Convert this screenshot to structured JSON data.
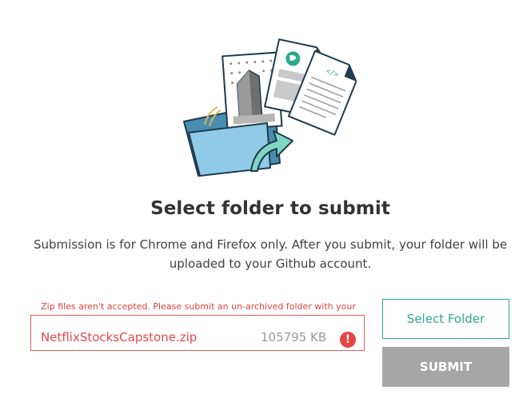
{
  "upload": {
    "title": "Select folder to submit",
    "description": "Submission is for Chrome and Firefox only. After you submit, your folder will be uploaded to your Github account.",
    "error_message": "Zip files aren't accepted. Please submit an un-archived folder with your project.",
    "file": {
      "name": "NetflixStocksCapstone.zip",
      "size": "105795 KB",
      "status_icon": "!"
    },
    "select_button_label": "Select Folder",
    "submit_button_label": "SUBMIT"
  },
  "colors": {
    "accent": "#2aa98a",
    "error": "#e04a4a",
    "disabled": "#a6a6a6",
    "text_dark": "#333333"
  },
  "icons": {
    "illustration": "folder-upload-illustration",
    "error": "exclamation-circle-icon"
  }
}
